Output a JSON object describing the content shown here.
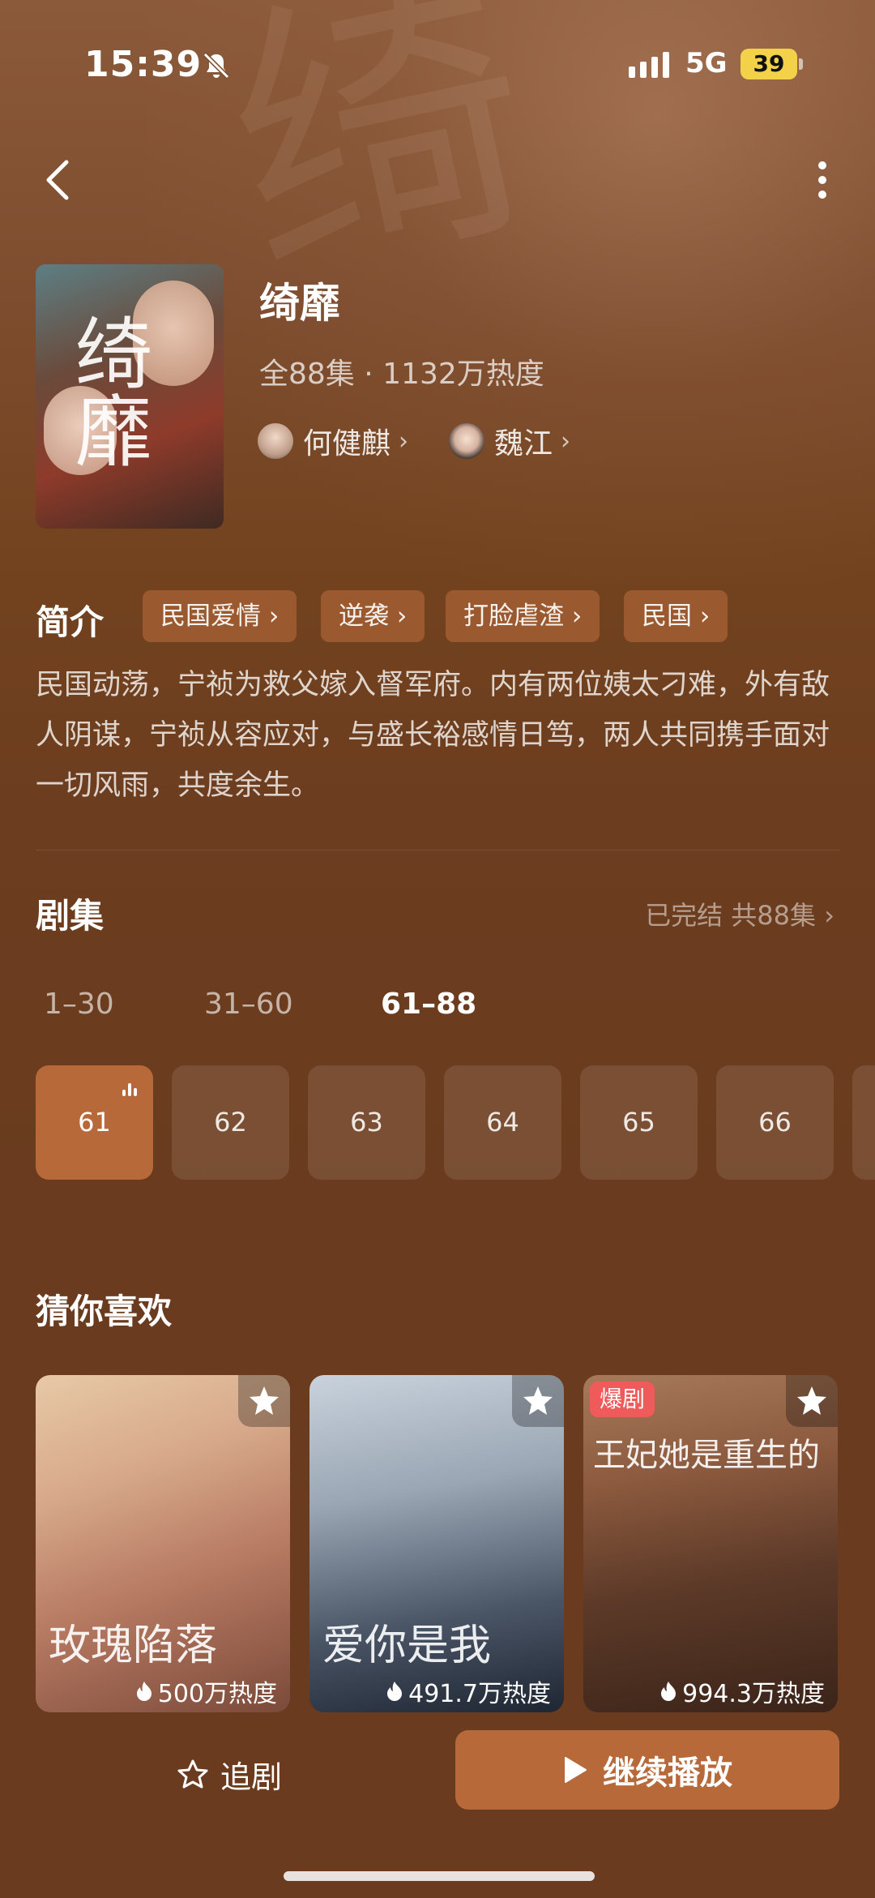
{
  "status_bar": {
    "time": "15:39",
    "network": "5G",
    "battery": "39"
  },
  "show": {
    "title": "绮靡",
    "meta": "全88集 · 1132万热度",
    "poster_title": "绮靡",
    "actors": [
      {
        "name": "何健麒"
      },
      {
        "name": "魏江"
      }
    ]
  },
  "intro": {
    "heading": "简介",
    "tags": [
      "民国爱情 ›",
      "逆袭 ›",
      "打脸虐渣 ›",
      "民国 ›"
    ],
    "description": "民国动荡，宁祯为救父嫁入督军府。内有两位姨太刁难，外有敌人阴谋，宁祯从容应对，与盛长裕感情日笃，两人共同携手面对一切风雨，共度余生。"
  },
  "episodes": {
    "heading": "剧集",
    "status": "已完结 共88集 ›",
    "ranges": [
      "1–30",
      "31–60",
      "61–88"
    ],
    "active_range": "61–88",
    "items": [
      "61",
      "62",
      "63",
      "64",
      "65",
      "66"
    ],
    "playing": "61"
  },
  "recommend": {
    "heading": "猜你喜欢",
    "items": [
      {
        "title": "玫瑰陷落",
        "heat": "500万热度",
        "badge": ""
      },
      {
        "title": "爱你是我",
        "heat": "491.7万热度",
        "badge": ""
      },
      {
        "title": "王妃她是重生的",
        "heat": "994.3万热度",
        "badge": "爆剧"
      }
    ]
  },
  "bottom_bar": {
    "follow_label": "追剧",
    "play_label": "继续播放"
  },
  "colors": {
    "accent": "#b8693a",
    "background": "#6a3b1e",
    "tag_bg": "#8e5a35",
    "badge": "#ef5a5a",
    "battery": "#f3d24a"
  },
  "icons": [
    "bell-mute-icon",
    "signal-icon",
    "back-icon",
    "more-icon",
    "chevron-right-icon",
    "equalizer-icon",
    "star-icon",
    "flame-icon",
    "star-outline-icon",
    "play-icon"
  ]
}
